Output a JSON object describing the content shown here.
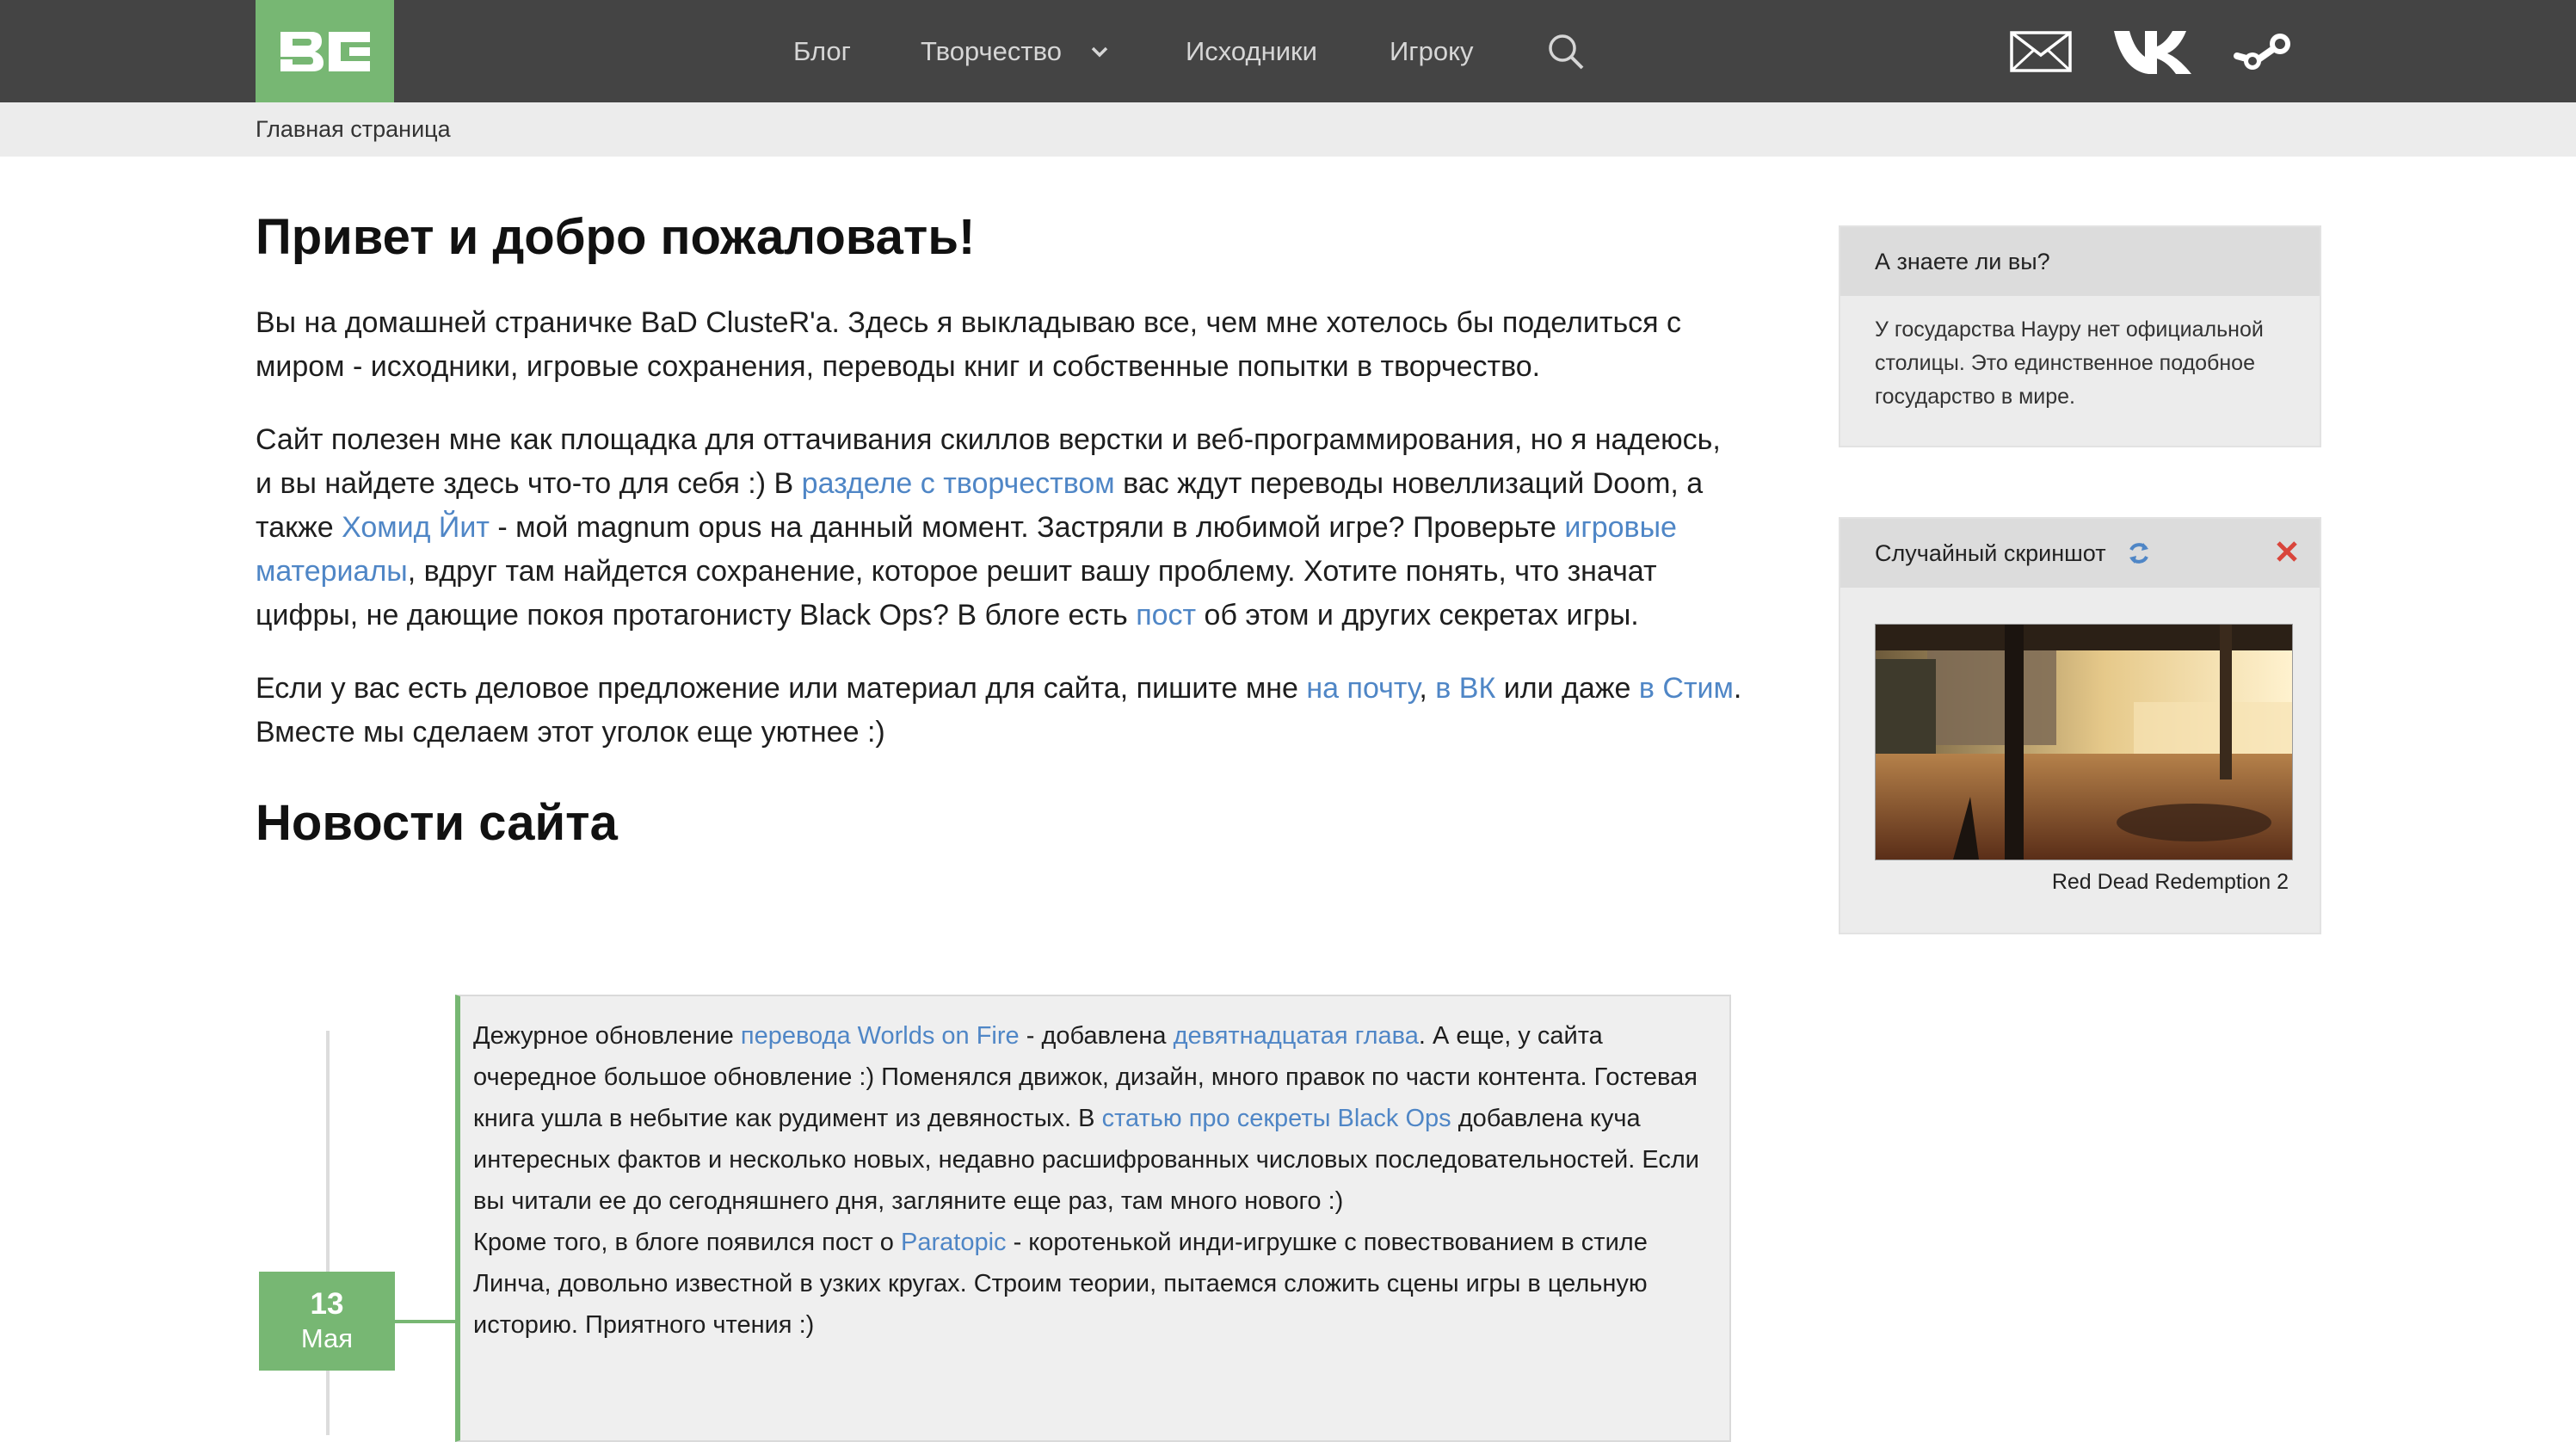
{
  "header": {
    "logo_text": "BC",
    "nav": {
      "blog": "Блог",
      "creative": "Творчество",
      "sources": "Исходники",
      "player": "Игроку"
    },
    "icons": [
      "search-icon",
      "mail-icon",
      "vk-icon",
      "steam-icon",
      "chevron-down-icon"
    ]
  },
  "breadcrumb": {
    "home": "Главная страница"
  },
  "main": {
    "title": "Привет и добро пожаловать!",
    "p1": "Вы на домашней страничке BaD ClusteR'a. Здесь я выкладываю все, чем мне хотелось бы поделиться с миром - исходники, игровые сохранения, переводы книг и собственные попытки в творчество.",
    "p2": {
      "t1": "Сайт полезен мне как площадка для оттачивания скиллов верстки и веб-программирования, но я надеюсь, и вы найдете здесь что-то для себя :) В ",
      "l1": "разделе с творчеством",
      "t2": " вас ждут переводы новеллизаций Doom, а также ",
      "l2": "Хомид Йит",
      "t3": " - мой magnum opus на данный момент. Застряли в любимой игре? Проверьте ",
      "l3": "игровые материалы",
      "t4": ", вдруг там найдется сохранение, которое решит вашу проблему. Хотите понять, что значат цифры, не дающие покоя протагонисту Black Ops? В блоге есть ",
      "l4": "пост",
      "t5": " об этом и других секретах игры."
    },
    "p3": {
      "t1": "Если у вас есть деловое предложение или материал для сайта, пишите мне ",
      "l1": "на почту",
      "t2": ", ",
      "l2": "в ВК",
      "t3": " или даже ",
      "l3": "в Стим",
      "t4": ". Вместе мы сделаем этот уголок еще уютнее :)"
    },
    "news_title": "Новости сайта"
  },
  "news": [
    {
      "day": "13",
      "month": "Мая",
      "para1": {
        "t1": "Дежурное обновление ",
        "l1": "перевода Worlds on Fire",
        "t2": " - добавлена ",
        "l2": "девятнадцатая глава",
        "t3": ". А еще, у сайта очередное большое обновление :) Поменялся движок, дизайн, много правок по части контента. Гостевая книга ушла в небытие как рудимент из девяностых. В ",
        "l3": "статью про секреты Black Ops",
        "t4": " добавлена куча интересных фактов и несколько новых, недавно расшифрованных числовых последовательностей. Если вы читали ее до сегодняшнего дня, загляните еще раз, там много нового :)"
      },
      "para2": {
        "t1": "Кроме того, в блоге появился пост о ",
        "l1": "Paratopic",
        "t2": " - коротенькой инди-игрушке с повествованием в стиле Линча, довольно известной в узких кругах. Строим теории, пытаемся сложить сцены игры в цельную историю. Приятного чтения :)"
      }
    }
  ],
  "sidebar": {
    "facts": {
      "title": "А знаете ли вы?",
      "text": "У государства Науру нет официальной столицы. Это единственное подобное государство в мире."
    },
    "screenshot": {
      "title": "Случайный скриншот",
      "caption": "Red Dead Redemption 2"
    }
  },
  "colors": {
    "header_bg": "#444444",
    "accent_green": "#77b773",
    "link": "#4f86c6",
    "close_red": "#d9453b"
  }
}
